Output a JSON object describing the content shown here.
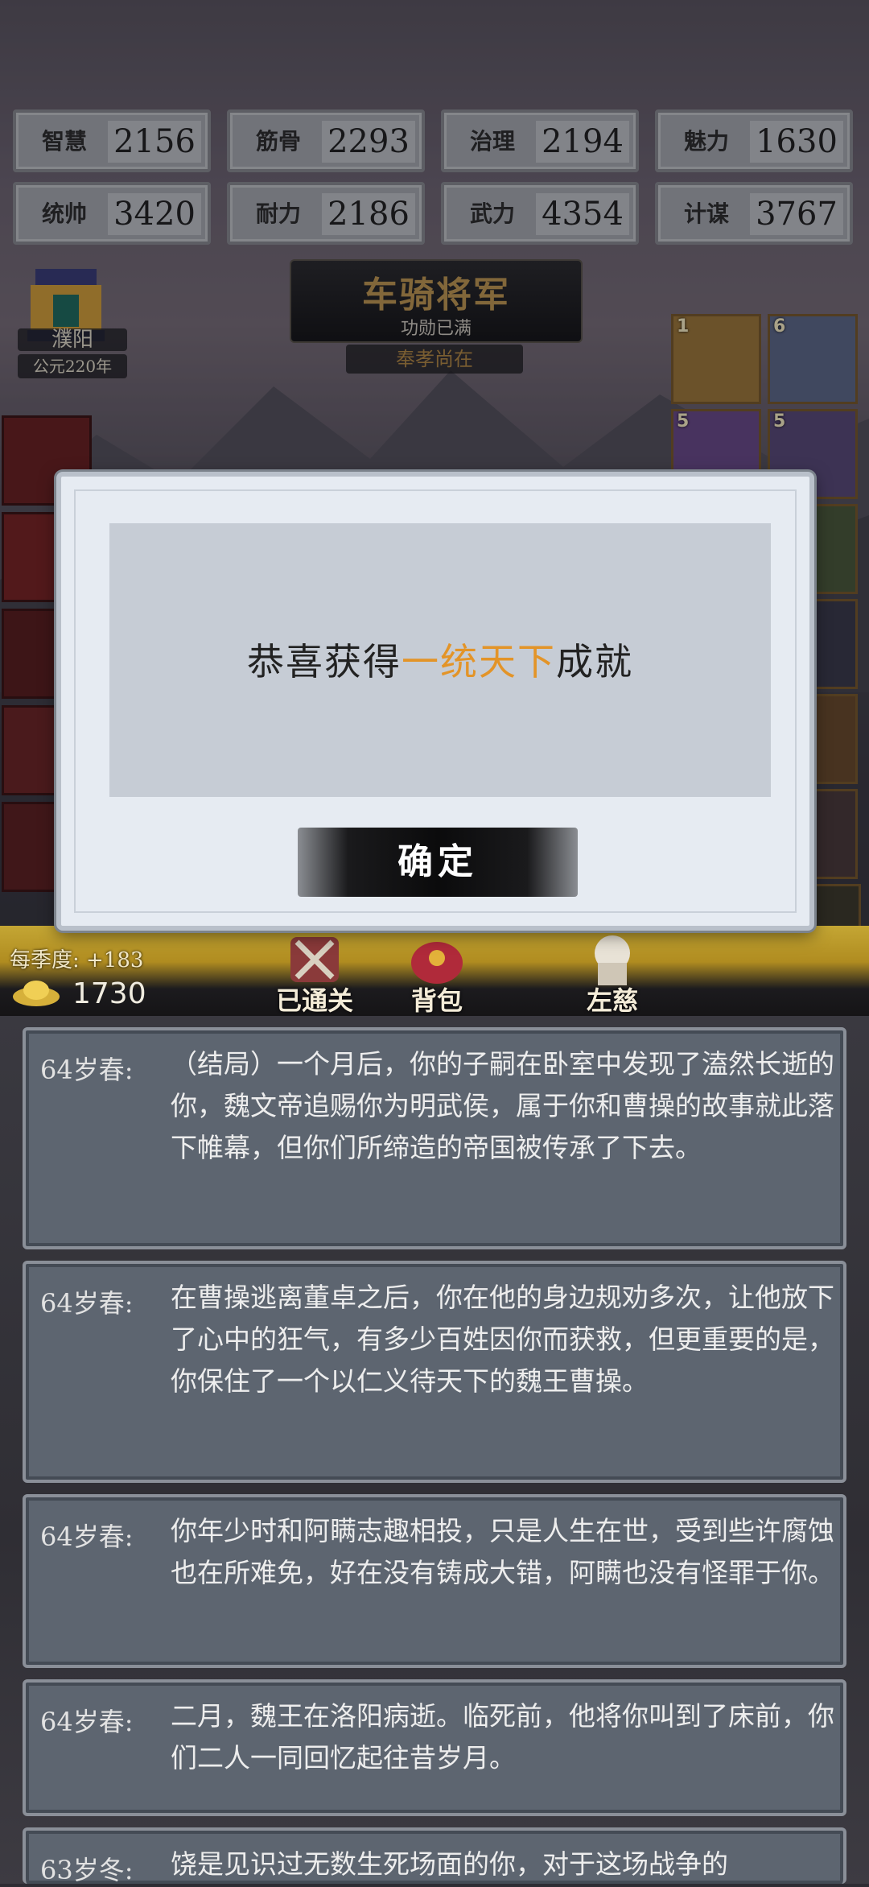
{
  "stats": [
    {
      "label": "智慧",
      "value": "2156"
    },
    {
      "label": "筋骨",
      "value": "2293"
    },
    {
      "label": "治理",
      "value": "2194"
    },
    {
      "label": "魅力",
      "value": "1630"
    },
    {
      "label": "统帅",
      "value": "3420"
    },
    {
      "label": "耐力",
      "value": "2186"
    },
    {
      "label": "武力",
      "value": "4354"
    },
    {
      "label": "计谋",
      "value": "3767"
    }
  ],
  "location": {
    "name": "濮阳",
    "year": "公元220年"
  },
  "rank": {
    "title": "车骑将军",
    "subtitle": "功勋已满",
    "status": "奉孝尚在"
  },
  "general_levels": [
    "1",
    "6",
    "5",
    "5"
  ],
  "season_bonus": "每季度: +183",
  "gold": "1730",
  "nav": {
    "cleared": "已通关",
    "bag": "背包",
    "third": "左慈"
  },
  "dialog": {
    "prefix": "恭喜获得",
    "highlight": "一统天下",
    "suffix": "成就",
    "ok_label": "确定"
  },
  "log": [
    {
      "age": "64岁春:",
      "text": "（结局）一个月后，你的子嗣在卧室中发现了溘然长逝的你，魏文帝追赐你为明武侯，属于你和曹操的故事就此落下帷幕，但你们所缔造的帝国被传承了下去。"
    },
    {
      "age": "64岁春:",
      "text": "在曹操逃离董卓之后，你在他的身边规劝多次，让他放下了心中的狂气，有多少百姓因你而获救，但更重要的是，你保住了一个以仁义待天下的魏王曹操。"
    },
    {
      "age": "64岁春:",
      "text": "你年少时和阿瞒志趣相投，只是人生在世，受到些许腐蚀也在所难免，好在没有铸成大错，阿瞒也没有怪罪于你。"
    },
    {
      "age": "64岁春:",
      "text": "二月，魏王在洛阳病逝。临死前，他将你叫到了床前，你们二人一同回忆起往昔岁月。"
    },
    {
      "age": "63岁冬:",
      "text": "饶是见识过无数生死场面的你，对于这场战争的"
    }
  ],
  "colors": {
    "highlight": "#e39428",
    "gold": "#c4a634",
    "panel": "#5d6570"
  }
}
